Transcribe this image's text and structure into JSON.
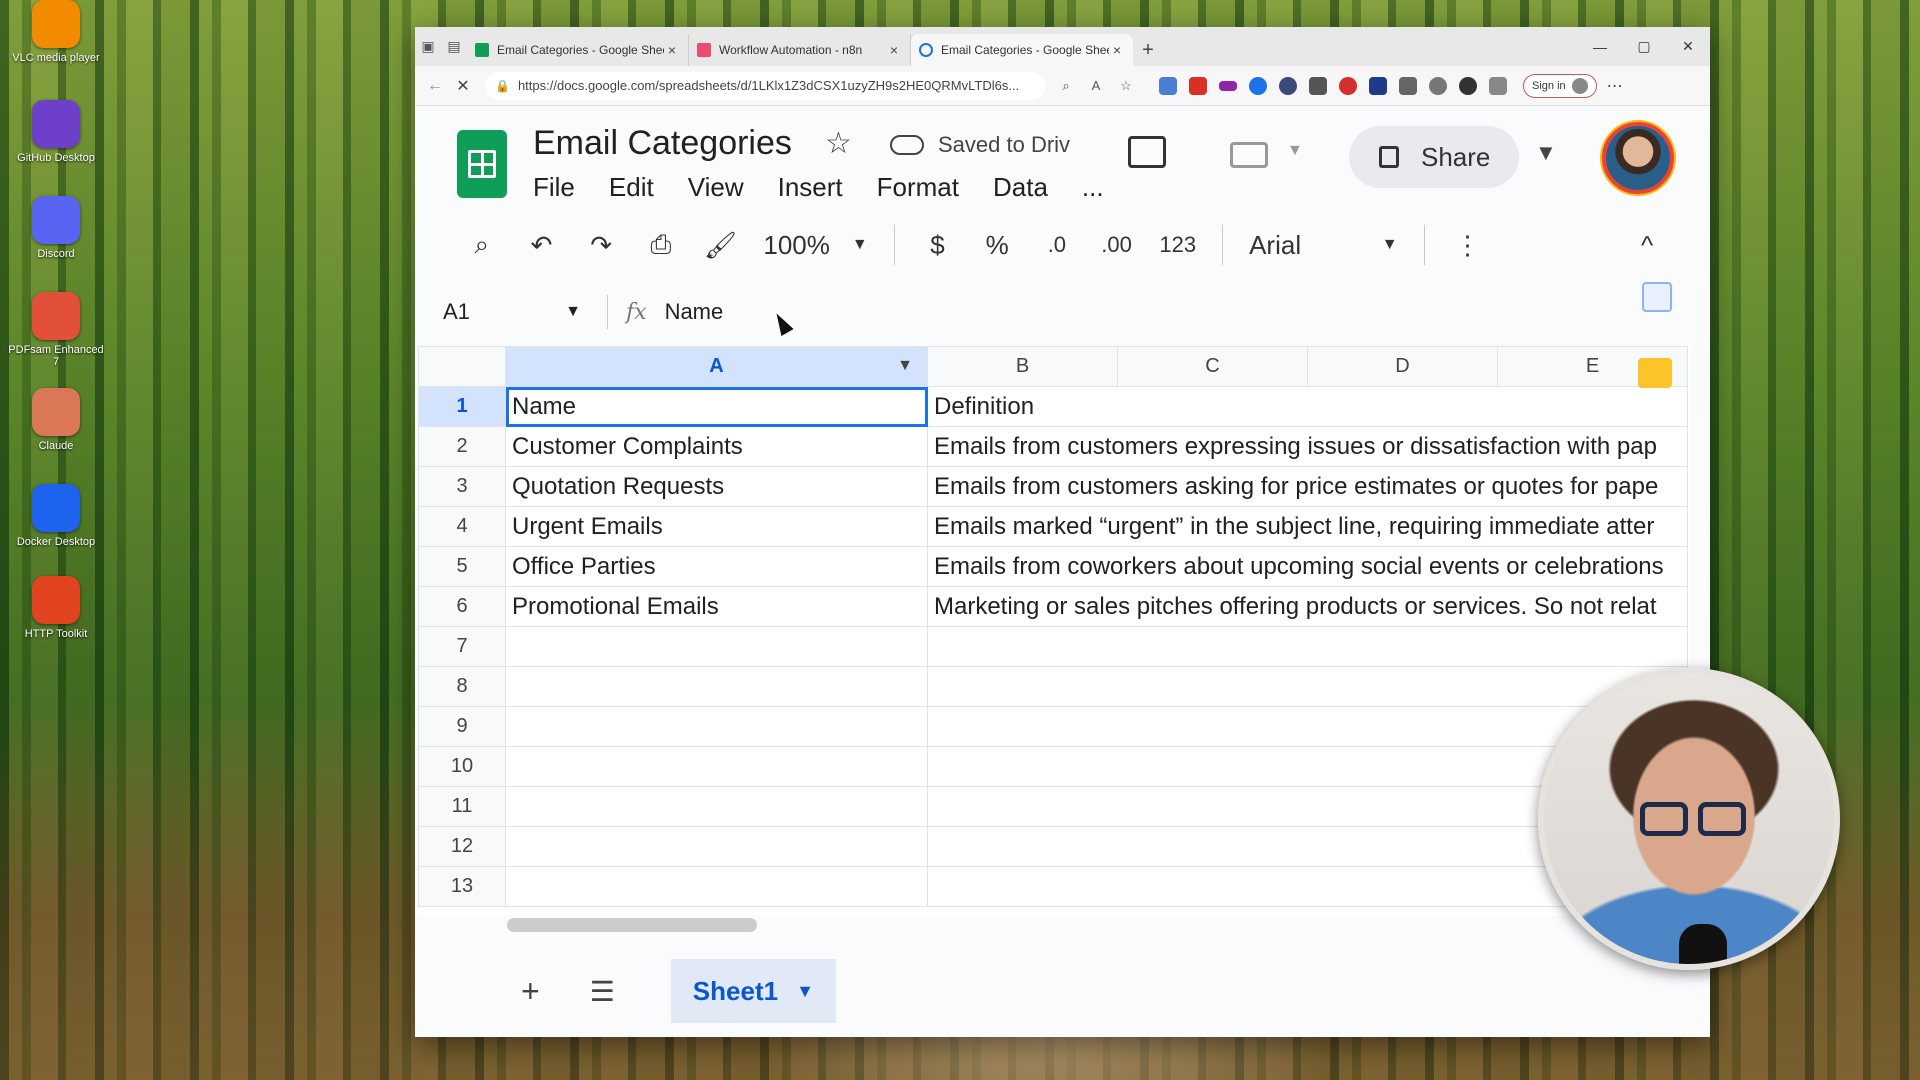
{
  "desktop": {
    "icons": [
      {
        "label": "VLC media player",
        "icon": "vlc-icon",
        "color": "#f28b00"
      },
      {
        "label": "GitHub Desktop",
        "icon": "github-icon",
        "color": "#6e40c9"
      },
      {
        "label": "Discord",
        "icon": "discord-icon",
        "color": "#5865f2"
      },
      {
        "label": "PDFsam Enhanced 7",
        "icon": "pdfsam-icon",
        "color": "#e2503a"
      },
      {
        "label": "Claude",
        "icon": "claude-icon",
        "color": "#d97757"
      },
      {
        "label": "Docker Desktop",
        "icon": "docker-icon",
        "color": "#1d63ed"
      },
      {
        "label": "HTTP Toolkit",
        "icon": "http-toolkit-icon",
        "color": "#e1421f"
      }
    ]
  },
  "browser": {
    "tabs": [
      {
        "title": "Email Categories - Google Sheets",
        "favicon": "sheets-favicon",
        "active": false
      },
      {
        "title": "Workflow Automation - n8n",
        "favicon": "n8n-favicon",
        "active": false
      },
      {
        "title": "Email Categories - Google Sheets",
        "favicon": "sheets-favicon",
        "active": true
      }
    ],
    "new_tab": "+",
    "url": "https://docs.google.com/spreadsheets/d/1LKlx1Z3dCSX1uzyZH9s2HE0QRMvLTDl6s...",
    "sign_in": "Sign in"
  },
  "sheets": {
    "title": "Email Categories",
    "saved_status": "Saved to Driv",
    "menu": [
      "File",
      "Edit",
      "View",
      "Insert",
      "Format",
      "Data",
      "..."
    ],
    "share_label": "Share",
    "toolbar": {
      "zoom": "100%",
      "currency": "$",
      "percent": "%",
      "decrease_decimal": ".0",
      "increase_decimal": ".00",
      "number_format": "123",
      "font": "Arial"
    },
    "name_box": "A1",
    "formula_icon": "fx",
    "formula_value": "Name",
    "columns": [
      "A",
      "B",
      "C",
      "D",
      "E"
    ],
    "rows": [
      {
        "num": "1",
        "a": "Name",
        "b": "Definition"
      },
      {
        "num": "2",
        "a": "Customer Complaints",
        "b": "Emails from customers expressing issues or dissatisfaction with pap"
      },
      {
        "num": "3",
        "a": "Quotation Requests",
        "b": "Emails from customers asking for price estimates or quotes for pape"
      },
      {
        "num": "4",
        "a": "Urgent Emails",
        "b": "Emails marked “urgent” in the subject line, requiring immediate atter"
      },
      {
        "num": "5",
        "a": "Office Parties",
        "b": "Emails from coworkers about upcoming social events or celebrations"
      },
      {
        "num": "6",
        "a": "Promotional Emails",
        "b": "Marketing or sales pitches offering products or services. So not relat"
      },
      {
        "num": "7",
        "a": "",
        "b": ""
      },
      {
        "num": "8",
        "a": "",
        "b": ""
      },
      {
        "num": "9",
        "a": "",
        "b": ""
      },
      {
        "num": "10",
        "a": "",
        "b": ""
      },
      {
        "num": "11",
        "a": "",
        "b": ""
      },
      {
        "num": "12",
        "a": "",
        "b": ""
      },
      {
        "num": "13",
        "a": "",
        "b": ""
      }
    ],
    "sheet_tab": "Sheet1",
    "add_sheet": "+",
    "accent": "#0b57d0"
  }
}
